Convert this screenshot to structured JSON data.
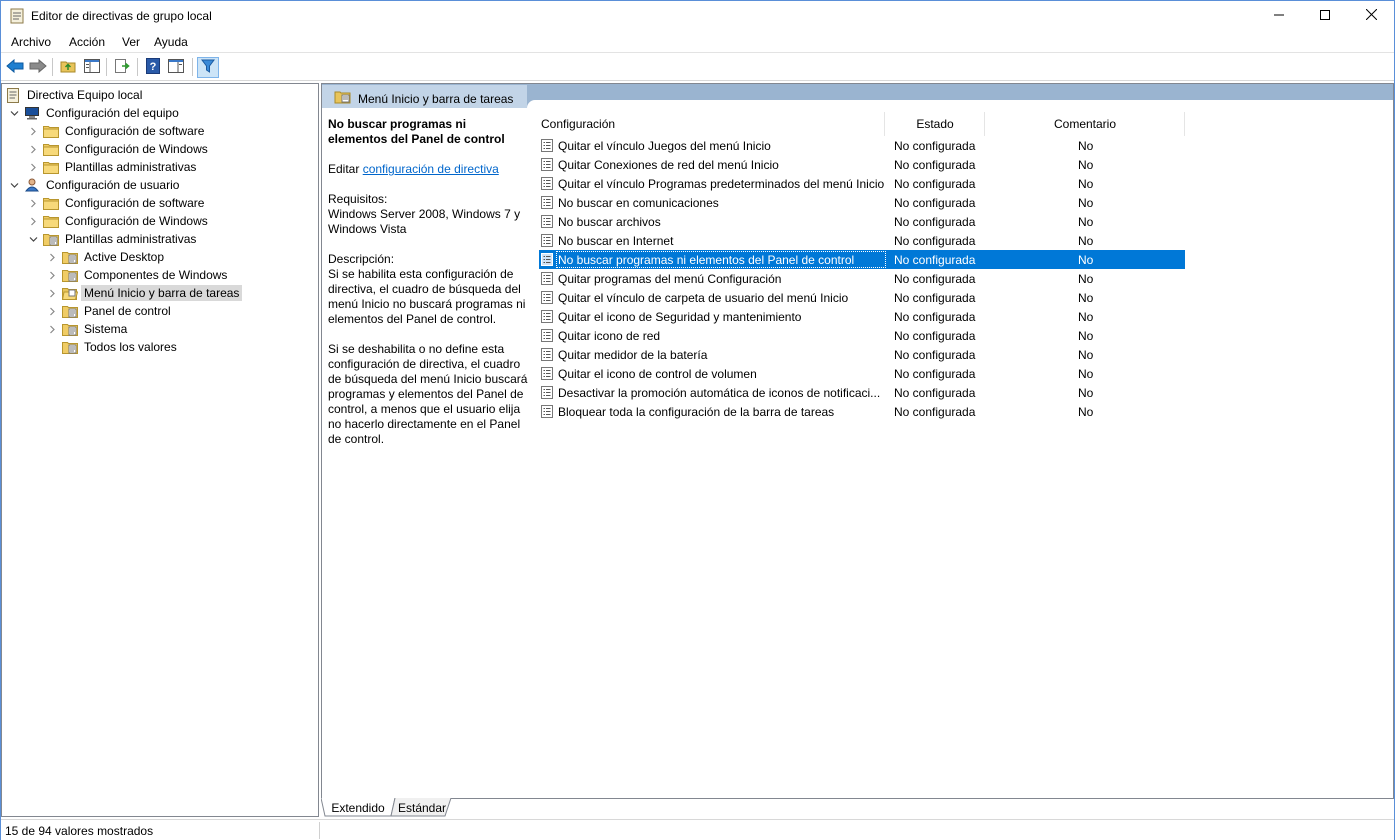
{
  "window": {
    "title": "Editor de directivas de grupo local",
    "minimize_icon": "minimize-icon",
    "maximize_icon": "maximize-icon",
    "close_icon": "close-icon"
  },
  "menubar": {
    "items": [
      "Archivo",
      "Acción",
      "Ver",
      "Ayuda"
    ]
  },
  "toolbar": {
    "icons": [
      "back-arrow-icon",
      "forward-arrow-icon",
      "up-folder-icon",
      "show-hide-tree-icon",
      "export-list-icon",
      "help-icon",
      "show-hide-action-pane-icon",
      "filter-icon"
    ]
  },
  "tree": {
    "items": [
      {
        "label": "Directiva Equipo local",
        "level": 0,
        "expander": "none",
        "icon": "policy-document-icon"
      },
      {
        "label": "Configuración del equipo",
        "level": 1,
        "expander": "expanded",
        "icon": "computer-icon"
      },
      {
        "label": "Configuración de software",
        "level": 2,
        "expander": "collapsed",
        "icon": "folder-icon"
      },
      {
        "label": "Configuración de Windows",
        "level": 2,
        "expander": "collapsed",
        "icon": "folder-icon"
      },
      {
        "label": "Plantillas administrativas",
        "level": 2,
        "expander": "collapsed",
        "icon": "folder-icon"
      },
      {
        "label": "Configuración de usuario",
        "level": 1,
        "expander": "expanded",
        "icon": "user-icon"
      },
      {
        "label": "Configuración de software",
        "level": 2,
        "expander": "collapsed",
        "icon": "folder-icon"
      },
      {
        "label": "Configuración de Windows",
        "level": 2,
        "expander": "collapsed",
        "icon": "folder-icon"
      },
      {
        "label": "Plantillas administrativas",
        "level": 2,
        "expander": "expanded",
        "icon": "policy-folder-icon"
      },
      {
        "label": "Active Desktop",
        "level": 3,
        "expander": "collapsed",
        "icon": "policy-folder-icon"
      },
      {
        "label": "Componentes de Windows",
        "level": 3,
        "expander": "collapsed",
        "icon": "policy-folder-icon"
      },
      {
        "label": "Menú Inicio y barra de tareas",
        "level": 3,
        "expander": "collapsed",
        "icon": "policy-folder-open-icon",
        "selected": true
      },
      {
        "label": "Panel de control",
        "level": 3,
        "expander": "collapsed",
        "icon": "policy-folder-icon"
      },
      {
        "label": "Sistema",
        "level": 3,
        "expander": "collapsed",
        "icon": "policy-folder-icon"
      },
      {
        "label": "Todos los valores",
        "level": 3,
        "expander": "none",
        "icon": "policy-folder-icon"
      }
    ]
  },
  "right_pane": {
    "header_title": "Menú Inicio y barra de tareas",
    "description": {
      "policy_title": "No buscar programas ni elementos del Panel de control",
      "edit_prefix": "Editar",
      "edit_link": "configuración de directiva",
      "requirements_label": "Requisitos:",
      "requirements_text": "Windows Server 2008, Windows 7 y Windows Vista",
      "description_label": "Descripción:",
      "description_p1": "Si se habilita esta configuración de directiva, el cuadro de búsqueda del menú Inicio no buscará programas ni elementos del Panel de control.",
      "description_p2": "Si se deshabilita o no define esta configuración de directiva, el cuadro de búsqueda del menú Inicio buscará programas y elementos del Panel de control, a menos que el usuario elija no hacerlo directamente en el Panel de control."
    },
    "columns": {
      "setting": "Configuración",
      "state": "Estado",
      "comment": "Comentario"
    },
    "rows": [
      {
        "name": "Quitar el vínculo Juegos del menú Inicio",
        "state": "No configurada",
        "comment": "No"
      },
      {
        "name": "Quitar Conexiones de red del menú Inicio",
        "state": "No configurada",
        "comment": "No"
      },
      {
        "name": "Quitar el vínculo Programas predeterminados del menú Inicio",
        "state": "No configurada",
        "comment": "No"
      },
      {
        "name": "No buscar en comunicaciones",
        "state": "No configurada",
        "comment": "No"
      },
      {
        "name": "No buscar archivos",
        "state": "No configurada",
        "comment": "No"
      },
      {
        "name": "No buscar en Internet",
        "state": "No configurada",
        "comment": "No"
      },
      {
        "name": "No buscar programas ni elementos del Panel de control",
        "state": "No configurada",
        "comment": "No",
        "selected": true
      },
      {
        "name": "Quitar programas del menú Configuración",
        "state": "No configurada",
        "comment": "No"
      },
      {
        "name": "Quitar el vínculo de carpeta de usuario del menú Inicio",
        "state": "No configurada",
        "comment": "No"
      },
      {
        "name": "Quitar el icono de Seguridad y mantenimiento",
        "state": "No configurada",
        "comment": "No"
      },
      {
        "name": "Quitar icono de red",
        "state": "No configurada",
        "comment": "No"
      },
      {
        "name": "Quitar medidor de la batería",
        "state": "No configurada",
        "comment": "No"
      },
      {
        "name": "Quitar el icono de control de volumen",
        "state": "No configurada",
        "comment": "No"
      },
      {
        "name": "Desactivar la promoción automática de iconos de notificaci...",
        "state": "No configurada",
        "comment": "No"
      },
      {
        "name": "Bloquear toda la configuración de la barra de tareas",
        "state": "No configurada",
        "comment": "No"
      }
    ]
  },
  "bottom_tabs": {
    "extended": "Extendido",
    "standard": "Estándar"
  },
  "status": {
    "text": "15 de 94 valores mostrados"
  },
  "colors": {
    "selection": "#0078d7",
    "header_band": "#9ab4d0",
    "link": "#0066cc"
  }
}
